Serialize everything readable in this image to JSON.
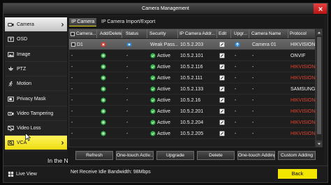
{
  "window": {
    "title": "Camera Management",
    "close_icon": "close-icon"
  },
  "colors": {
    "selected_item_bg": "#c4c4c4",
    "vca_highlight": "#eedd10",
    "back_button": "#f2e600",
    "close_button": "#b81414",
    "protocol_highlight": "#e2412f",
    "active_green": "#35b54a",
    "delete_red": "#d8392e",
    "upgrade_blue": "#2e8fe0"
  },
  "sidebar": {
    "items": [
      {
        "label": "Camera",
        "icon": "camera-icon",
        "state": "selected",
        "chevron": true
      },
      {
        "label": "OSD",
        "icon": "osd-icon"
      },
      {
        "label": "Image",
        "icon": "image-icon"
      },
      {
        "label": "PTZ",
        "icon": "ptz-icon"
      },
      {
        "label": "Motion",
        "icon": "motion-icon"
      },
      {
        "label": "Privacy Mask",
        "icon": "privacy-mask-icon"
      },
      {
        "label": "Video Tampering",
        "icon": "video-tampering-icon"
      },
      {
        "label": "Video Loss",
        "icon": "video-loss-icon"
      },
      {
        "label": "VCA",
        "icon": "vca-icon",
        "state": "hover",
        "chevron": true
      }
    ],
    "live_view": {
      "label": "Live View",
      "icon": "live-view-icon"
    }
  },
  "tabs": [
    {
      "label": "IP Camera",
      "active": true
    },
    {
      "label": "IP Camera Import/Export",
      "active": false
    }
  ],
  "table": {
    "headers": [
      "Camera...",
      "Add/Delete",
      "Status",
      "Security",
      "IP Camera Addr...",
      "Edit",
      "Upgr...",
      "Camera Name",
      "Protocol"
    ],
    "rows": [
      {
        "checkbox": true,
        "camera_no": "D1",
        "add_delete_icon": "delete-icon",
        "status_icon": "camera-status-icon",
        "status": null,
        "security": "Weak Pass...",
        "security_icon": null,
        "ip": "10.5.2.203",
        "edit_icon": "edit-icon",
        "upgrade_icon": "upgrade-icon",
        "upgrade": null,
        "camera_name": "Camera 01",
        "protocol": "HIKVISION",
        "protocol_highlight": false,
        "selected": true
      },
      {
        "checkbox": false,
        "camera_no": "-",
        "add_delete_icon": "add-icon",
        "status_icon": null,
        "status": "-",
        "security": "Active",
        "security_icon": "active-icon",
        "ip": "10.5.2.101",
        "edit_icon": "edit-icon",
        "upgrade_icon": null,
        "upgrade": "-",
        "camera_name": "-",
        "protocol": "ONVIF",
        "protocol_highlight": false,
        "selected": false
      },
      {
        "checkbox": false,
        "camera_no": "-",
        "add_delete_icon": "add-icon",
        "status_icon": null,
        "status": "-",
        "security": "Active",
        "security_icon": "active-icon",
        "ip": "10.5.2.116",
        "edit_icon": "edit-icon",
        "upgrade_icon": null,
        "upgrade": "-",
        "camera_name": "-",
        "protocol": "HIKVISION",
        "protocol_highlight": true,
        "selected": false
      },
      {
        "checkbox": false,
        "camera_no": "-",
        "add_delete_icon": "add-icon",
        "status_icon": null,
        "status": "-",
        "security": "Active",
        "security_icon": "active-icon",
        "ip": "10.5.2.111",
        "edit_icon": "edit-icon",
        "upgrade_icon": null,
        "upgrade": "-",
        "camera_name": "-",
        "protocol": "HIKVISION",
        "protocol_highlight": true,
        "selected": false
      },
      {
        "checkbox": false,
        "camera_no": "-",
        "add_delete_icon": "add-icon",
        "status_icon": null,
        "status": "-",
        "security": "Active",
        "security_icon": "active-icon",
        "ip": "10.5.2.133",
        "edit_icon": "edit-icon",
        "upgrade_icon": null,
        "upgrade": "-",
        "camera_name": "-",
        "protocol": "SAMSUNG",
        "protocol_highlight": false,
        "selected": false
      },
      {
        "checkbox": false,
        "camera_no": "-",
        "add_delete_icon": "add-icon",
        "status_icon": null,
        "status": "-",
        "security": "Active",
        "security_icon": "active-icon",
        "ip": "10.5.2.16",
        "edit_icon": "edit-icon",
        "upgrade_icon": null,
        "upgrade": "-",
        "camera_name": "-",
        "protocol": "HIKVISION",
        "protocol_highlight": true,
        "selected": false
      },
      {
        "checkbox": false,
        "camera_no": "-",
        "add_delete_icon": "add-icon",
        "status_icon": null,
        "status": "-",
        "security": "Active",
        "security_icon": "active-icon",
        "ip": "10.5.2.201",
        "edit_icon": "edit-icon",
        "upgrade_icon": null,
        "upgrade": "-",
        "camera_name": "-",
        "protocol": "HIKVISION",
        "protocol_highlight": true,
        "selected": false
      },
      {
        "checkbox": false,
        "camera_no": "-",
        "add_delete_icon": "add-icon",
        "status_icon": null,
        "status": "-",
        "security": "Active",
        "security_icon": "active-icon",
        "ip": "10.5.2.204",
        "edit_icon": "edit-icon",
        "upgrade_icon": null,
        "upgrade": "-",
        "camera_name": "-",
        "protocol": "HIKVISION",
        "protocol_highlight": true,
        "selected": false
      },
      {
        "checkbox": false,
        "camera_no": "-",
        "add_delete_icon": "add-icon",
        "status_icon": null,
        "status": "-",
        "security": "Active",
        "security_icon": "active-icon",
        "ip": "10.5.2.205",
        "edit_icon": "edit-icon",
        "upgrade_icon": null,
        "upgrade": "-",
        "camera_name": "-",
        "protocol": "HIKVISION",
        "protocol_highlight": true,
        "selected": false
      }
    ]
  },
  "buttons": [
    "Refresh",
    "One-touch Activ...",
    "Upgrade",
    "Delete",
    "One-touch Adding",
    "Custom Adding"
  ],
  "footer": {
    "bandwidth": "Net Receive Idle Bandwidth: 98Mbps",
    "back_label": "Back"
  },
  "caption": "In the N"
}
